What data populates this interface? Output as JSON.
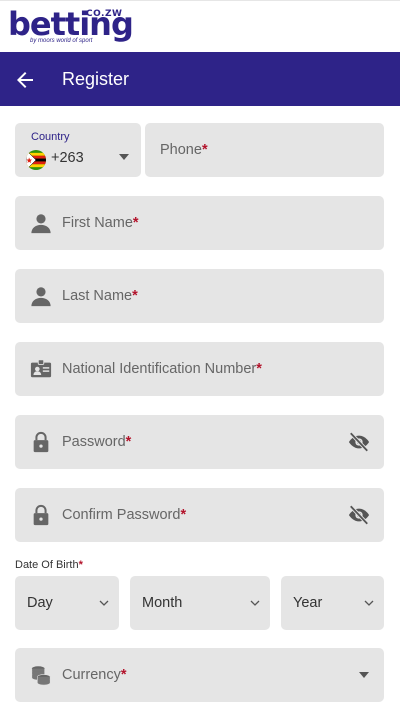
{
  "brand": {
    "name": "betting",
    "tld": "CO.ZW",
    "tagline": "by moors world of sport",
    "color": "#2e2388"
  },
  "header": {
    "title": "Register",
    "back_icon": "arrow-left-icon"
  },
  "form": {
    "country": {
      "label": "Country",
      "code": "+263",
      "flag_icon": "zimbabwe-flag-icon"
    },
    "phone": {
      "label": "Phone",
      "required_mark": "*"
    },
    "first_name": {
      "label": "First Name",
      "required_mark": "*",
      "icon": "user-icon"
    },
    "last_name": {
      "label": "Last Name",
      "required_mark": "*",
      "icon": "user-icon"
    },
    "national_id": {
      "label": "National Identification Number",
      "required_mark": "*",
      "icon": "id-card-icon"
    },
    "password": {
      "label": "Password",
      "required_mark": "*",
      "icon": "lock-icon",
      "toggle_icon": "eye-slash-icon"
    },
    "confirm_password": {
      "label": "Confirm Password",
      "required_mark": "*",
      "icon": "lock-icon",
      "toggle_icon": "eye-slash-icon"
    },
    "dob": {
      "label": "Date Of Birth",
      "required_mark": "*",
      "day": "Day",
      "month": "Month",
      "year": "Year"
    },
    "currency": {
      "label": "Currency",
      "required_mark": "*",
      "icon": "coins-icon"
    }
  },
  "colors": {
    "header_bg": "#2e2388",
    "field_bg": "#e5e5e5",
    "required": "#b3132b"
  }
}
